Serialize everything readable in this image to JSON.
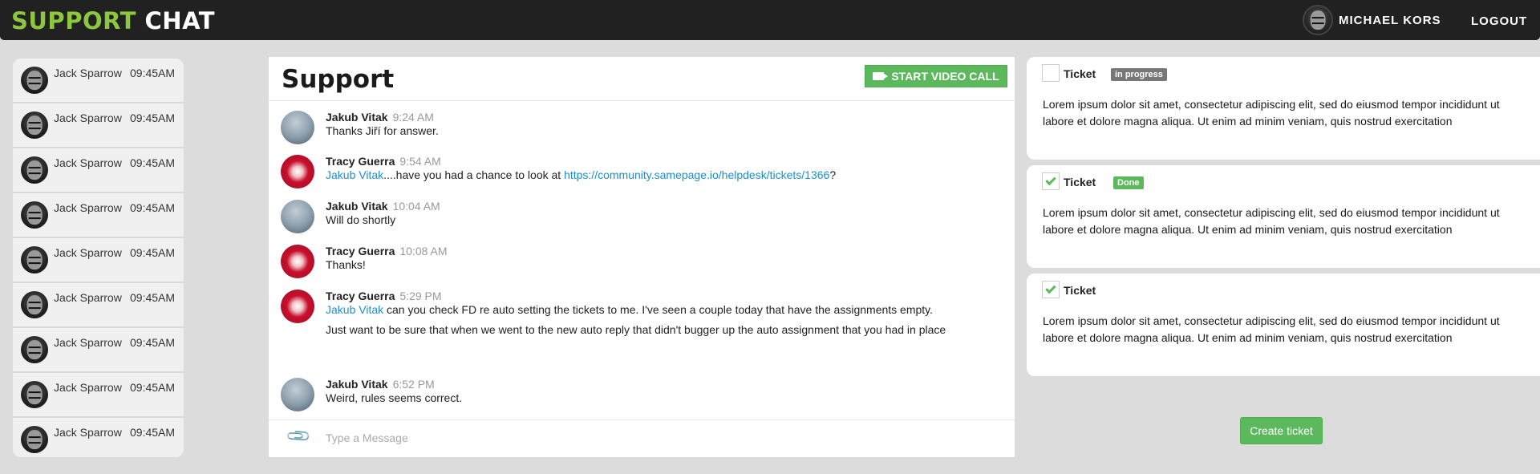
{
  "header": {
    "brand_part1": "SUPPORT",
    "brand_part2": "CHAT",
    "user_name": "MICHAEL KORS",
    "logout_label": "LOGOUT"
  },
  "contacts": [
    {
      "name": "Jack Sparrow",
      "time": "09:45AM"
    },
    {
      "name": "Jack Sparrow",
      "time": "09:45AM"
    },
    {
      "name": "Jack Sparrow",
      "time": "09:45AM"
    },
    {
      "name": "Jack Sparrow",
      "time": "09:45AM"
    },
    {
      "name": "Jack Sparrow",
      "time": "09:45AM"
    },
    {
      "name": "Jack Sparrow",
      "time": "09:45AM"
    },
    {
      "name": "Jack Sparrow",
      "time": "09:45AM"
    },
    {
      "name": "Jack Sparrow",
      "time": "09:45AM"
    },
    {
      "name": "Jack Sparrow",
      "time": "09:45AM"
    }
  ],
  "chat": {
    "title": "Support",
    "video_call_label": "START VIDEO CALL",
    "input_placeholder": "Type a Message",
    "messages": [
      {
        "author": "Jakub Vitak",
        "time": "9:24 AM",
        "text": "Thanks Jiří for answer."
      },
      {
        "author": "Tracy Guerra",
        "time": "9:54 AM",
        "mention": "Jakub Vitak",
        "text_mid": "....have you had a chance to look at ",
        "link": "https://community.samepage.io/helpdesk/tickets/1366",
        "text_end": "?"
      },
      {
        "author": "Jakub Vitak",
        "time": "10:04 AM",
        "text": "Will do shortly"
      },
      {
        "author": "Tracy Guerra",
        "time": "10:08 AM",
        "text": "Thanks!"
      },
      {
        "author": "Tracy Guerra",
        "time": "5:29 PM",
        "mention": "Jakub Vitak",
        "text": " can you check FD re auto setting the tickets to me. I've seen a couple today that have the assignments empty.",
        "text2": "Just want to be sure that when we went to the new auto reply that didn't bugger up the auto assignment that you had in place"
      },
      {
        "author": "Jakub Vitak",
        "time": "6:52 PM",
        "text": "Weird, rules seems correct."
      }
    ]
  },
  "tickets": [
    {
      "label": "Ticket",
      "checked": false,
      "badge": "in progress",
      "description": "Lorem ipsum dolor sit amet, consectetur adipiscing elit, sed do eiusmod tempor incididunt ut labore et dolore magna aliqua. Ut enim ad minim veniam, quis nostrud exercitation"
    },
    {
      "label": "Ticket",
      "checked": true,
      "badge": "Done",
      "description": "Lorem ipsum dolor sit amet, consectetur adipiscing elit, sed do eiusmod tempor incididunt ut labore et dolore magna aliqua. Ut enim ad minim veniam, quis nostrud exercitation"
    },
    {
      "label": "Ticket",
      "checked": true,
      "badge": "",
      "description": "Lorem ipsum dolor sit amet, consectetur adipiscing elit, sed do eiusmod tempor incididunt ut labore et dolore magna aliqua. Ut enim ad minim veniam, quis nostrud exercitation"
    }
  ],
  "create_ticket_label": "Create ticket",
  "colors": {
    "brand_green": "#8dc63f",
    "button_green": "#5cb85c",
    "link_blue": "#1a8fd1",
    "header_bg": "#212121",
    "page_bg": "#dcdcdc"
  }
}
